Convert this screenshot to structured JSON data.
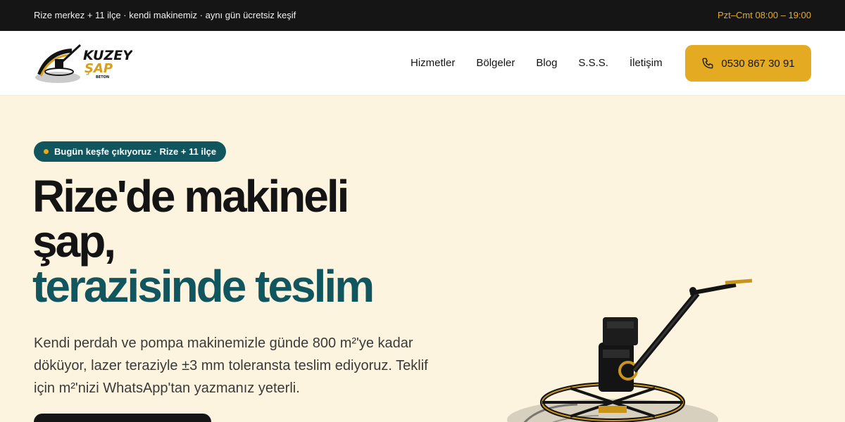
{
  "topbar": {
    "info": "Rize merkez + 11 ilçe · kendi makinemiz · aynı gün ücretsiz keşif",
    "hours": "Pzt–Cmt 08:00 – 19:00"
  },
  "brand": {
    "name_line1": "KUZEY",
    "name_line2": "ŞAP",
    "name_line3": "BETON"
  },
  "nav": {
    "items": [
      {
        "label": "Hizmetler"
      },
      {
        "label": "Bölgeler"
      },
      {
        "label": "Blog"
      },
      {
        "label": "S.S.S."
      },
      {
        "label": "İletişim"
      }
    ],
    "phone": "0530 867 30 91"
  },
  "hero": {
    "badge": "Bugün keşfe çıkıyoruz · Rize + 11 ilçe",
    "title_line1": "Rize'de makineli",
    "title_line2": "şap,",
    "title_line3": "terazisinde teslim",
    "lead": "Kendi perdah ve pompa makinemizle günde 800 m²'ye kadar döküyor, lazer teraziyle ±3 mm toleransta teslim ediyoruz. Teklif için m²'nizi WhatsApp'tan yazmanız yeterli."
  },
  "colors": {
    "accent": "#e3aa22",
    "teal": "#11565f",
    "background": "#fdf4e0",
    "dark": "#151515"
  }
}
